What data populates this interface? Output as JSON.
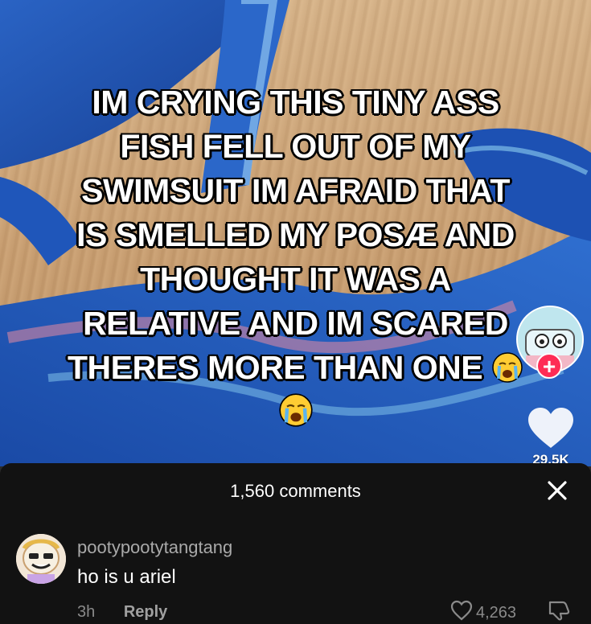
{
  "video": {
    "caption_lines": [
      "IM CRYING THIS TINY ASS",
      "FISH FELL OUT OF MY",
      "SWIMSUIT IM AFRAID THAT",
      "IS SMELLED MY POSÆ AND",
      "THOUGHT IT WAS A",
      "RELATIVE AND IM SCARED",
      "THERES MORE THAN ONE"
    ],
    "emoji": "loudly-crying-face-emoji",
    "like_count": "29.5K",
    "follow_symbol": "+"
  },
  "comments": {
    "title": "1,560 comments",
    "items": [
      {
        "username": "pootypootytangtang",
        "text": "ho is u ariel",
        "time": "3h",
        "reply_label": "Reply",
        "likes": "4,263"
      }
    ]
  },
  "colors": {
    "accent": "#fe2c55",
    "sheet_bg": "#121212",
    "cloth_blue": "#1f55b8"
  }
}
